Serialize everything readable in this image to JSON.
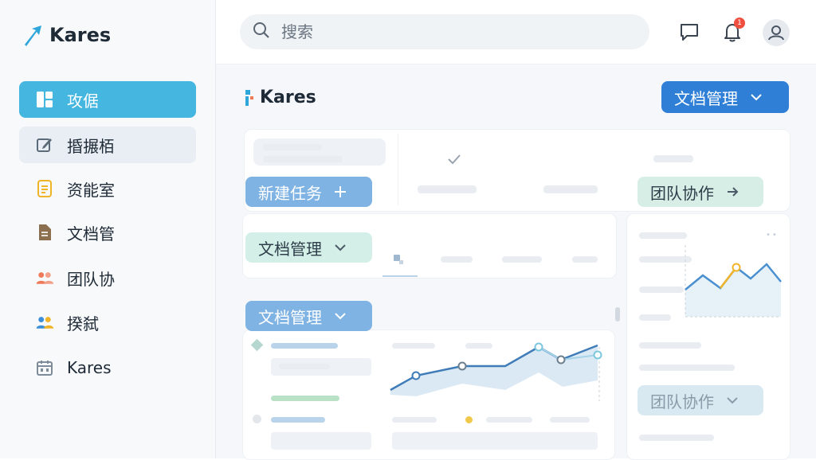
{
  "app": {
    "brand": "Kares"
  },
  "sidebar": {
    "items": [
      {
        "label": "攻倨",
        "icon": "dashboard-icon",
        "state": "active"
      },
      {
        "label": "捪搌栢",
        "icon": "edit-icon",
        "state": "hover"
      },
      {
        "label": "资能室",
        "icon": "document-icon",
        "state": "normal"
      },
      {
        "label": "文档管",
        "icon": "file-icon",
        "state": "normal"
      },
      {
        "label": "团队协",
        "icon": "team-icon",
        "state": "normal"
      },
      {
        "label": "揆弑",
        "icon": "users-icon",
        "state": "normal"
      },
      {
        "label": "Kares",
        "icon": "calendar-icon",
        "state": "normal"
      }
    ]
  },
  "header": {
    "search": {
      "placeholder": "搜索"
    },
    "notifications": {
      "count": "1"
    }
  },
  "main": {
    "brand": "Kares",
    "doc_dropdown_top": "文档管理",
    "new_task": "新建任务",
    "team_collab_top": "团队协作",
    "doc_dropdown_green": "文档管理",
    "doc_dropdown_blue": "文档管理",
    "team_collab_bottom": "团队协作"
  },
  "colors": {
    "accent": "#44b6df",
    "primary": "#2f7fd6",
    "badge": "#ef4f3f",
    "chart_line": "#4a7fb5",
    "chart_highlight": "#f0b429"
  }
}
